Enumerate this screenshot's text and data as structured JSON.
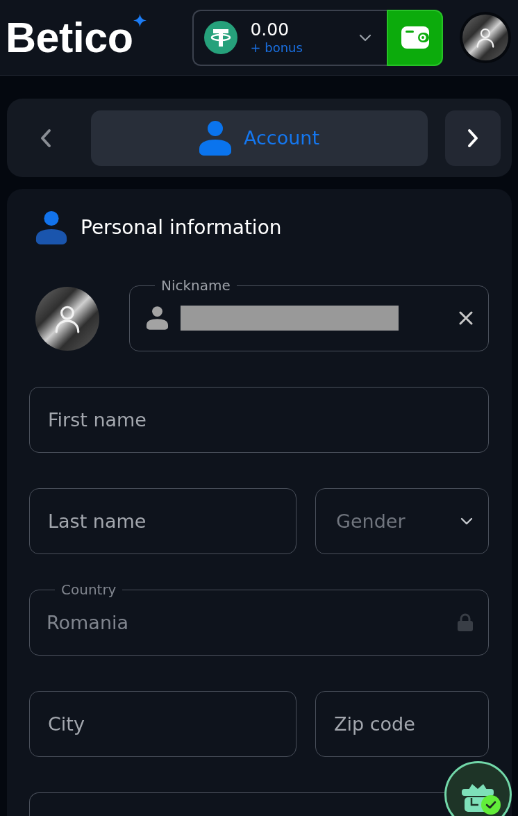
{
  "header": {
    "logo": "Betico",
    "balance": {
      "amount": "0.00",
      "bonus": "+ bonus"
    }
  },
  "nav": {
    "prev_disabled": true,
    "tabs": [
      {
        "label": "Account",
        "selected": true
      }
    ]
  },
  "personal_information": {
    "title": "Personal information",
    "nickname": {
      "label": "Nickname",
      "value_hidden": true,
      "clearable": true
    },
    "rows": [
      [
        {
          "kind": "text",
          "placeholder": "First name"
        }
      ],
      [
        {
          "kind": "text",
          "placeholder": "Last name"
        },
        {
          "kind": "select",
          "placeholder": "Gender"
        }
      ],
      [
        {
          "kind": "text",
          "label": "Country",
          "value": "Romania",
          "disabled": true
        }
      ],
      [
        {
          "kind": "text",
          "placeholder": "City"
        },
        {
          "kind": "text",
          "placeholder": "Zip code"
        }
      ],
      [
        {
          "kind": "text"
        }
      ]
    ]
  }
}
